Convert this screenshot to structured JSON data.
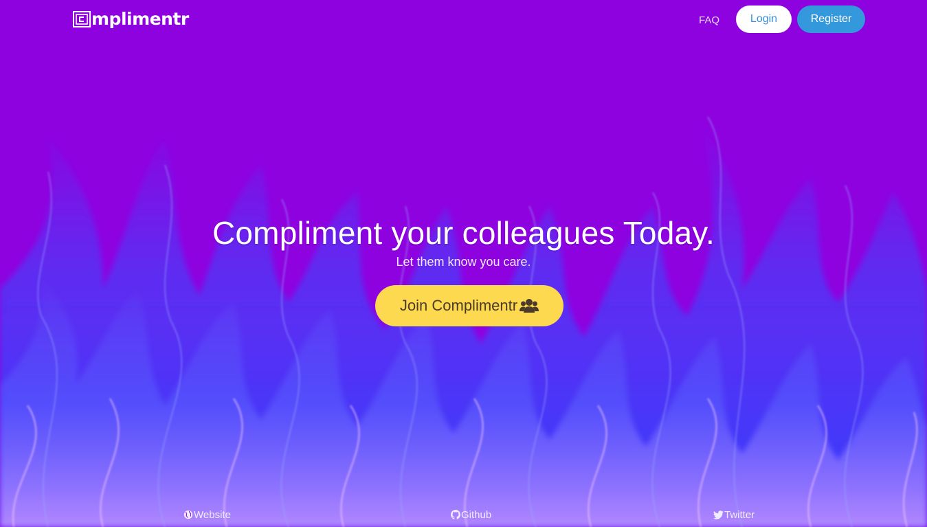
{
  "brand": {
    "logo_text": "mplimentr",
    "logo_icon": "framed-c-logo-icon"
  },
  "nav": {
    "faq_label": "FAQ",
    "login_label": "Login",
    "register_label": "Register"
  },
  "hero": {
    "title": "Compliment your colleagues Today.",
    "subtitle": "Let them know you care.",
    "cta_label": "Join Complimentr",
    "cta_icon": "users-icon"
  },
  "footer": {
    "links": [
      {
        "label": "Website",
        "icon": "globe-icon"
      },
      {
        "label": "Github",
        "icon": "github-icon"
      },
      {
        "label": "Twitter",
        "icon": "twitter-icon"
      }
    ]
  },
  "colors": {
    "background": "#8e02e0",
    "flame_blue": "#3b4bff",
    "flame_pink": "#e9a8ff",
    "cta_yellow": "#fcd94f",
    "register_blue": "#3499dc"
  }
}
